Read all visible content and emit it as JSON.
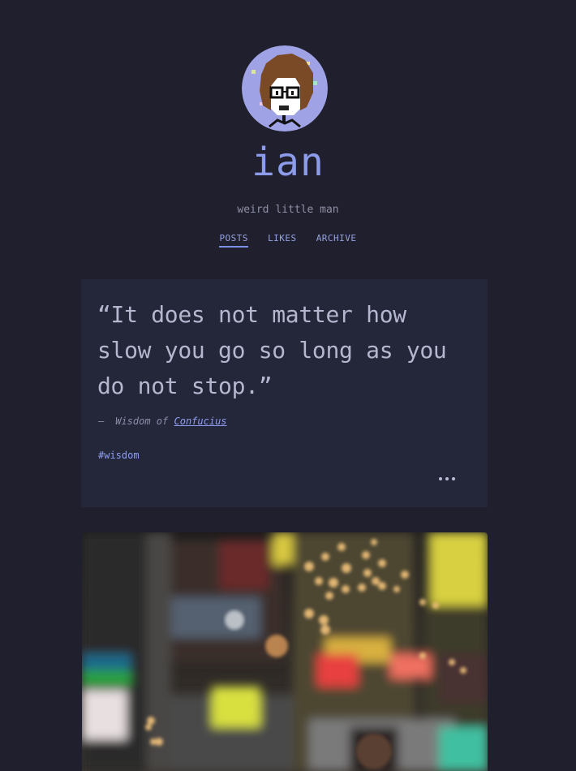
{
  "blog": {
    "title": "ian",
    "description": "weird little man",
    "avatar_icon": "pixel-avatar-icon"
  },
  "nav": {
    "items": [
      {
        "label": "POSTS",
        "active": true
      },
      {
        "label": "LIKES",
        "active": false
      },
      {
        "label": "ARCHIVE",
        "active": false
      }
    ]
  },
  "quote_post": {
    "text": "“It does not matter how slow you go so long as you do not stop.”",
    "dash": "—",
    "source_prefix": "Wisdom of",
    "source_link": "Confucius",
    "tag": "#wisdom",
    "more_icon": "more-dots-icon"
  },
  "photo_post": {
    "image_icon": "city-night-bokeh-photo"
  },
  "colors": {
    "background": "#201f2e",
    "card": "#24263a",
    "accent": "#8c9bea",
    "text": "#a9adc6"
  }
}
